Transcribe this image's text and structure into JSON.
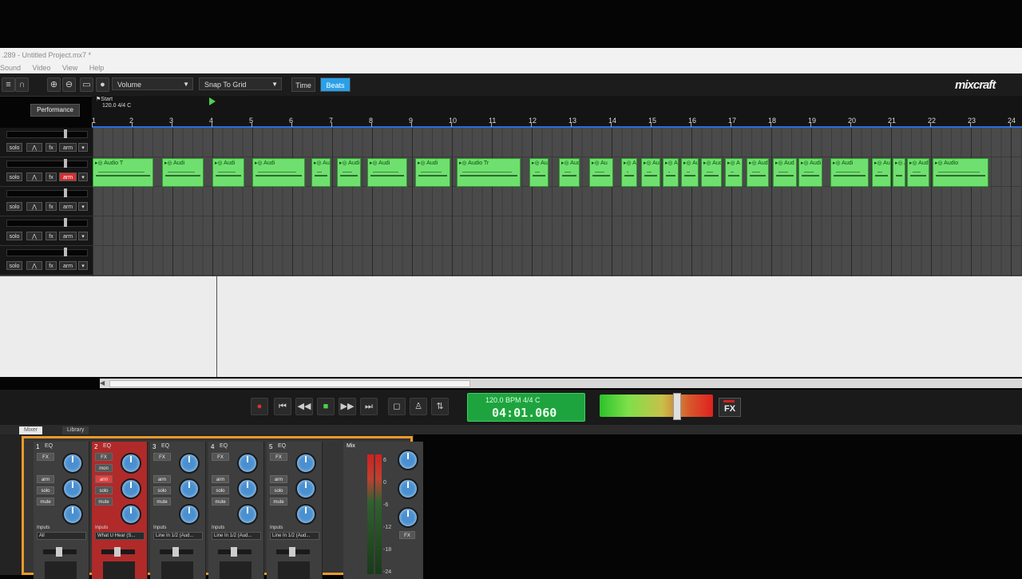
{
  "window": {
    "title": ".289 - Untitled Project.mx7 *",
    "menu": [
      "Sound",
      "Video",
      "View",
      "Help"
    ]
  },
  "toolbar": {
    "volume_dropdown": "Volume",
    "snap_dropdown": "Snap To Grid",
    "time_label": "Time",
    "beats_label": "Beats",
    "logo": "mixcraft",
    "performance_button": "Performance"
  },
  "ruler": {
    "start_marker": "Start",
    "signature": "120.0 4/4 C",
    "bars": [
      "1",
      "2",
      "3",
      "4",
      "5",
      "6",
      "7",
      "8",
      "9",
      "10",
      "11",
      "12",
      "13",
      "14",
      "15",
      "16",
      "17",
      "18",
      "19",
      "20",
      "21",
      "22",
      "23",
      "24"
    ]
  },
  "tracks": {
    "buttons": {
      "solo": "solo",
      "fx": "fx",
      "arm": "arm"
    },
    "count": 5,
    "armed_track": 2
  },
  "clips": [
    {
      "label": "Audio T"
    },
    {
      "label": "Audi"
    },
    {
      "label": "Audi"
    },
    {
      "label": "Audi"
    },
    {
      "label": "Au"
    },
    {
      "label": "Audi"
    },
    {
      "label": "Audi"
    },
    {
      "label": "Audi"
    },
    {
      "label": "Audio Tr"
    },
    {
      "label": "Aud"
    },
    {
      "label": "Audi"
    },
    {
      "label": "Au"
    },
    {
      "label": "A"
    },
    {
      "label": "Au"
    },
    {
      "label": "A"
    },
    {
      "label": "Au"
    },
    {
      "label": "Aud"
    },
    {
      "label": "A"
    },
    {
      "label": "Aud"
    },
    {
      "label": "Aud"
    },
    {
      "label": "Audi"
    },
    {
      "label": "Audi"
    },
    {
      "label": "Au"
    },
    {
      "label": "A"
    },
    {
      "label": "Aud"
    },
    {
      "label": "Audio"
    }
  ],
  "transport": {
    "tempo_display": "120.0 BPM  4/4    C",
    "time_display": "04:01.060",
    "fx_label": "FX"
  },
  "mixer": {
    "tabs": [
      "Mixer",
      "Library"
    ],
    "strips": [
      {
        "number": "1",
        "inputs_label": "Inputs",
        "input_value": "All"
      },
      {
        "number": "2",
        "inputs_label": "Inputs",
        "input_value": "What U Hear (S..."
      },
      {
        "number": "3",
        "inputs_label": "Inputs",
        "input_value": "Line In 1/2 (Aud..."
      },
      {
        "number": "4",
        "inputs_label": "Inputs",
        "input_value": "Line In 1/2 (Aud..."
      },
      {
        "number": "5",
        "inputs_label": "Inputs",
        "input_value": "Line In 1/2 (Aud..."
      }
    ],
    "strip_buttons": {
      "fx": "FX",
      "mon": "mon",
      "arm": "arm",
      "solo": "solo",
      "mute": "mute"
    },
    "eq_label": "EQ",
    "master_label": "Mix",
    "scale": [
      "6",
      "0",
      "-6",
      "-12",
      "-18",
      "-24"
    ]
  }
}
